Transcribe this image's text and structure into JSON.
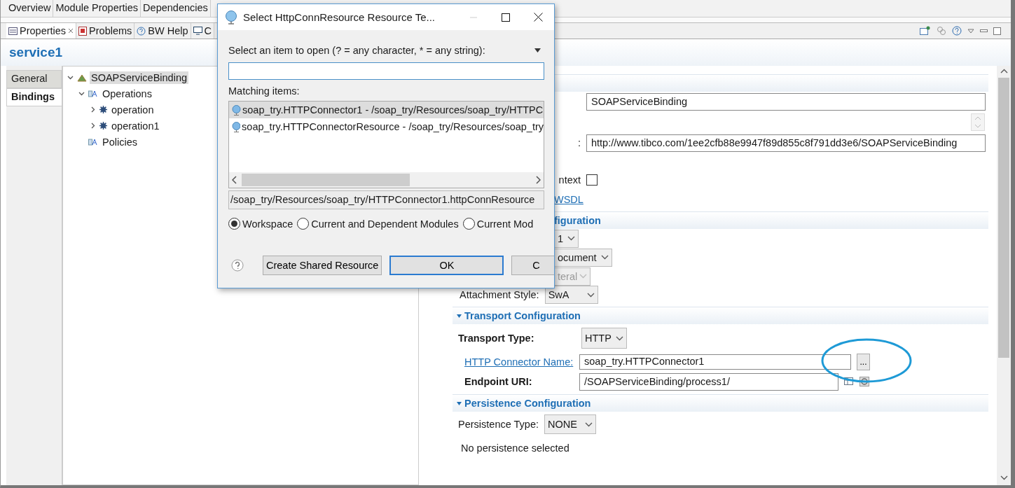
{
  "editor_tabs": [
    {
      "label": "Overview"
    },
    {
      "label": "Module Properties"
    },
    {
      "label": "Dependencies"
    }
  ],
  "view_tabs": [
    {
      "label": "Properties",
      "kind": "properties",
      "selected": true
    },
    {
      "label": "Problems",
      "kind": "problems",
      "selected": false
    },
    {
      "label": "BW Help",
      "kind": "help",
      "selected": false
    },
    {
      "label": "C",
      "kind": "console",
      "selected": false
    }
  ],
  "title": "service1",
  "side_tabs": [
    {
      "label": "General",
      "selected": false
    },
    {
      "label": "Bindings",
      "selected": true
    }
  ],
  "tree": [
    {
      "label": "SOAPServiceBinding",
      "kind": "binding",
      "expanded": true,
      "selected": true,
      "children": [
        {
          "label": "Operations",
          "kind": "folder",
          "expanded": true,
          "selected": false,
          "children": [
            {
              "label": "operation",
              "kind": "operation",
              "expanded": false,
              "selected": false
            },
            {
              "label": "operation1",
              "kind": "operation",
              "expanded": false,
              "selected": false
            }
          ]
        },
        {
          "label": "Policies",
          "kind": "folder",
          "selected": false
        }
      ]
    }
  ],
  "details": {
    "name_value": "SOAPServiceBinding",
    "namespace_label": ":",
    "namespace_value": "http://www.tibco.com/1ee2cfb88e9947f89d855c8f791dd3e6/SOAPServiceBinding",
    "context_label": "ntext",
    "context_checked": false,
    "wsdl_link": "WSDL",
    "config_title": "figuration",
    "combos": [
      {
        "value": "1",
        "disabled": false
      },
      {
        "value": "ocument",
        "disabled": false
      },
      {
        "value": "teral",
        "disabled": true
      }
    ],
    "attachment_label": "Attachment Style:",
    "attachment_value": "SwA",
    "transport": {
      "title": "Transport Configuration",
      "type_label": "Transport Type:",
      "type_value": "HTTP",
      "connector_label": "HTTP Connector Name:",
      "connector_value": "soap_try.HTTPConnector1",
      "browse_button": "...",
      "endpoint_label": "Endpoint URI:",
      "endpoint_value": "/SOAPServiceBinding/process1/"
    },
    "persistence": {
      "title": "Persistence Configuration",
      "type_label": "Persistence Type:",
      "type_value": "NONE",
      "note": "No persistence selected"
    }
  },
  "dialog": {
    "title": "Select HttpConnResource Resource Te...",
    "prompt": "Select an item to open (? = any character, * = any string):",
    "matching_label": "Matching items:",
    "items": [
      {
        "label": "soap_try.HTTPConnector1 - /soap_try/Resources/soap_try/HTTPC",
        "selected": true
      },
      {
        "label": "soap_try.HTTPConnectorResource - /soap_try/Resources/soap_try",
        "selected": false
      }
    ],
    "path": "/soap_try/Resources/soap_try/HTTPConnector1.httpConnResource",
    "scopes": [
      {
        "label": "Workspace",
        "selected": true
      },
      {
        "label": "Current and Dependent Modules",
        "selected": false
      },
      {
        "label": "Current Mod",
        "selected": false
      }
    ],
    "buttons": [
      {
        "label": "Create Shared Resource",
        "default": false
      },
      {
        "label": "OK",
        "default": true
      },
      {
        "label": "C",
        "default": false
      }
    ]
  }
}
